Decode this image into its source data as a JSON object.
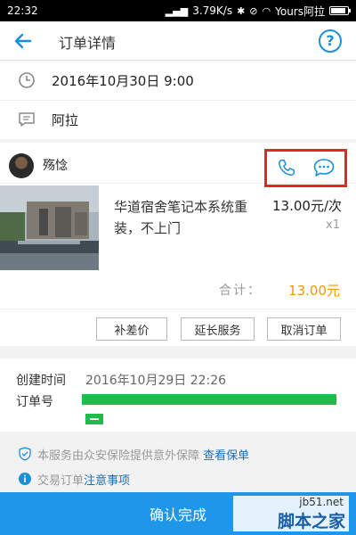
{
  "status_bar": {
    "time": "22:32",
    "speed": "3.79K/s",
    "carrier": "Yours阿拉"
  },
  "header": {
    "title": "订单详情"
  },
  "service_info": {
    "datetime": "2016年10月30日 9:00",
    "location": "阿拉"
  },
  "worker": {
    "name": "殇惗"
  },
  "item": {
    "name": "华道宿舍笔记本系统重装，不上门",
    "price": "13.00元/次",
    "quantity": "x1"
  },
  "total": {
    "label": "合计：",
    "value": "13.00元"
  },
  "actions": {
    "supplement_label": "补差价",
    "extend_label": "延长服务",
    "cancel_label": "取消订单"
  },
  "meta": {
    "created_label": "创建时间",
    "created_value": "2016年10月29日 22:26",
    "order_no_label": "订单号"
  },
  "notices": {
    "insurance_text": "本服务由众安保险提供意外保障",
    "insurance_link": "查看保单",
    "transaction_text": "交易订单",
    "transaction_link": "注意事项"
  },
  "footer": {
    "confirm_label": "确认完成"
  },
  "watermark": {
    "site": "jb51.net",
    "name": "脚本之家"
  },
  "colors": {
    "accent": "#1a8fdc",
    "price_total": "#f39800",
    "highlight_box": "#e3262d",
    "confirm_button": "#1f96e8"
  }
}
